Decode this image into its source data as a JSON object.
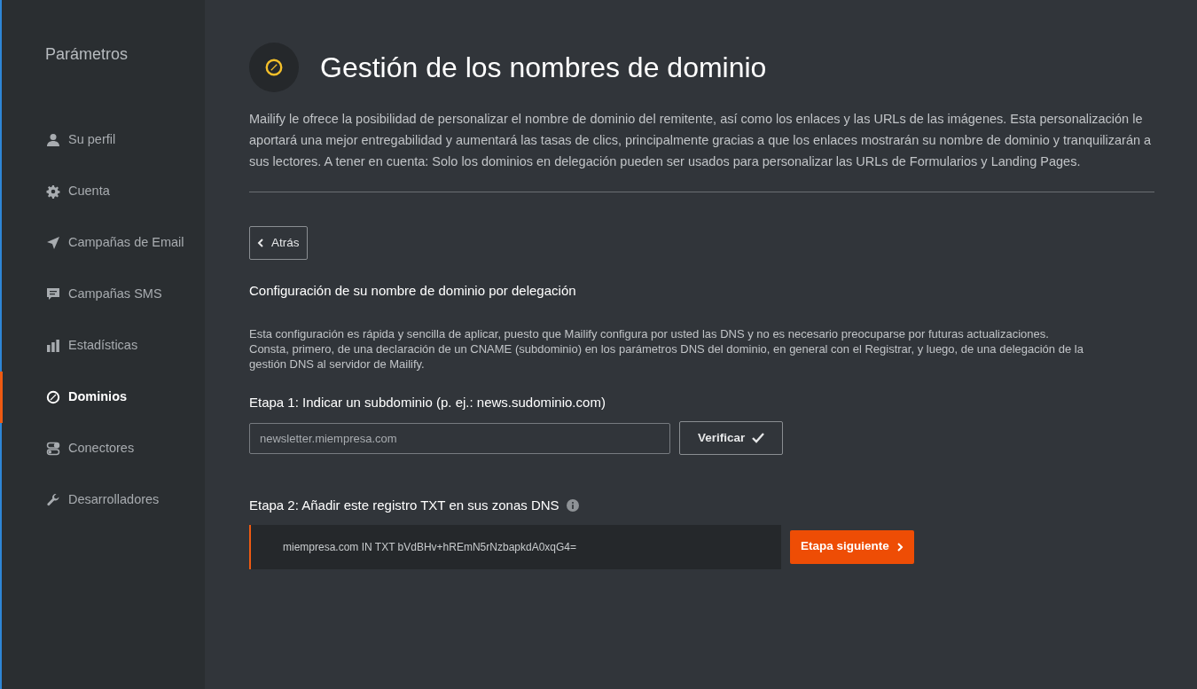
{
  "sidebar": {
    "title": "Parámetros",
    "items": [
      {
        "label": "Su perfil",
        "selected": false
      },
      {
        "label": "Cuenta",
        "selected": false
      },
      {
        "label": "Campañas de Email",
        "selected": false
      },
      {
        "label": "Campañas SMS",
        "selected": false
      },
      {
        "label": "Estadísticas",
        "selected": false
      },
      {
        "label": "Dominios",
        "selected": true
      },
      {
        "label": "Conectores",
        "selected": false
      },
      {
        "label": "Desarrolladores",
        "selected": false
      }
    ]
  },
  "header": {
    "title": "Gestión de los nombres de dominio",
    "description": "Mailify le ofrece la posibilidad de personalizar el nombre de dominio del remitente, así como los enlaces y las URLs de las imágenes. Esta personalización le aportará una mejor entregabilidad y aumentará las tasas de clics, principalmente gracias a que los enlaces mostrarán su nombre de dominio y tranquilizarán a sus lectores. A tener en cuenta: Solo los dominios en delegación pueden ser usados para personalizar las URLs de Formularios y Landing Pages."
  },
  "back_button": "Atrás",
  "section": {
    "title": "Configuración de su nombre de dominio por delegación",
    "description": "Esta configuración es rápida y sencilla de aplicar, puesto que Mailify configura por usted las DNS y no es necesario preocuparse por futuras actualizaciones. Consta, primero, de una declaración de un CNAME (subdominio) en los parámetros DNS del dominio, en general con el Registrar, y luego, de una delegación de la gestión DNS al servidor de Mailify."
  },
  "step1": {
    "label": "Etapa 1: Indicar un subdominio (p. ej.: news.sudominio.com)",
    "placeholder": "newsletter.miempresa.com",
    "button": "Verificar"
  },
  "step2": {
    "label": "Etapa 2: Añadir este registro TXT en sus zonas DNS",
    "record": "miempresa.com IN TXT bVdBHv+hREmN5rNzbapkdA0xqG4=",
    "button": "Etapa siguiente"
  }
}
